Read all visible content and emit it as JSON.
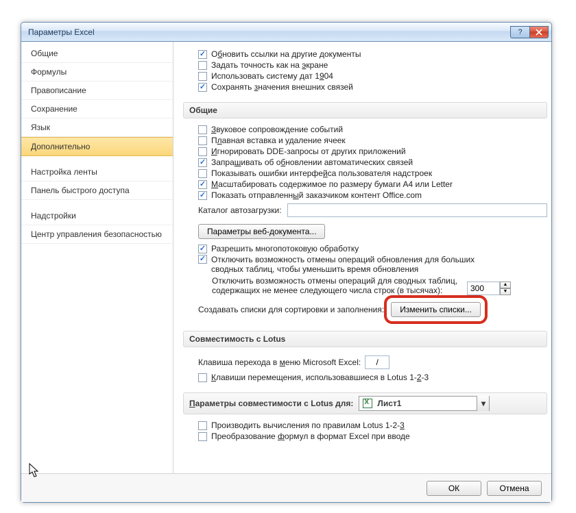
{
  "window_title": "Параметры Excel",
  "sidebar": {
    "items": [
      {
        "label": "Общие"
      },
      {
        "label": "Формулы"
      },
      {
        "label": "Правописание"
      },
      {
        "label": "Сохранение"
      },
      {
        "label": "Язык"
      },
      {
        "label": "Дополнительно"
      },
      {
        "label": "Настройка ленты"
      },
      {
        "label": "Панель быстрого доступа"
      },
      {
        "label": "Надстройки"
      },
      {
        "label": "Центр управления безопасностью"
      }
    ],
    "selected_index": 5
  },
  "top_checks": [
    {
      "checked": true,
      "label_html": "О<u>б</u>новить ссылки на другие документы"
    },
    {
      "checked": false,
      "label_html": "Задать точность как на <u>э</u>кране"
    },
    {
      "checked": false,
      "label_html": "Использовать систему дат 1<u>9</u>04"
    },
    {
      "checked": true,
      "label_html": "Сохранять <u>з</u>начения внешних связей"
    }
  ],
  "general": {
    "heading": "Общие",
    "checks": [
      {
        "checked": false,
        "label_html": "<u>З</u>вуковое сопровождение событий"
      },
      {
        "checked": false,
        "label_html": "П<u>л</u>авная вставка и удаление ячеек"
      },
      {
        "checked": false,
        "label_html": "<u>И</u>гнорировать DDE-запросы от других приложений"
      },
      {
        "checked": true,
        "label_html": "Запра<u>ш</u>ивать об о<u>б</u>новлении автоматических связей"
      },
      {
        "checked": false,
        "label_html": "Показывать ошибки интерфе<u>й</u>са пользователя надстроек"
      },
      {
        "checked": true,
        "label_html": "<u>М</u>асштабировать содержимое по размеру бумаги A4 или Letter"
      },
      {
        "checked": true,
        "label_html": "Показать отправленн<u>ы</u>й заказчиком контент Office.com"
      }
    ],
    "autoload_label": "Каталог автозагрузки:",
    "autoload_value": "",
    "web_doc_btn": "Параметры веб-документа...",
    "multithread": {
      "checked": true,
      "label_html": "Разрешить многопотоков<u>у</u>ю обработку"
    },
    "disable_undo_pivot": {
      "checked": true,
      "label_html": "Отключить возможность отмены операций обновления для больших сводных таблиц, чтобы уменьшить время обновления"
    },
    "disable_rows_label": "Отключить возможность отмены операций для сводных таблиц, содержащих не менее следующего числа строк (в тысячах):",
    "disable_rows_value": "300",
    "custom_lists_label": "Создавать списки для сортировки и заполнения:",
    "custom_lists_btn": "Изменить списки..."
  },
  "lotus_compat": {
    "heading": "Совместимость с Lotus",
    "menu_key_label_html": "Клавиша перехода в <u>м</u>еню Microsoft Excel:",
    "menu_key_value": "/",
    "nav_keys": {
      "checked": false,
      "label_html": "<u>К</u>лавиши перемещения, использовавшиеся в Lotus 1-<u>2</u>-3"
    }
  },
  "lotus_params": {
    "heading_html": "<u>П</u>араметры совместимости с Lotus для:",
    "sheet": "Лист1",
    "checks": [
      {
        "checked": false,
        "label_html": "Производить вычисления по правилам Lotus 1-2-<u>3</u>"
      },
      {
        "checked": false,
        "label_html": "Преобразование <u>ф</u>ормул в формат Excel при вводе"
      }
    ]
  },
  "footer": {
    "ok": "ОК",
    "cancel": "Отмена"
  }
}
